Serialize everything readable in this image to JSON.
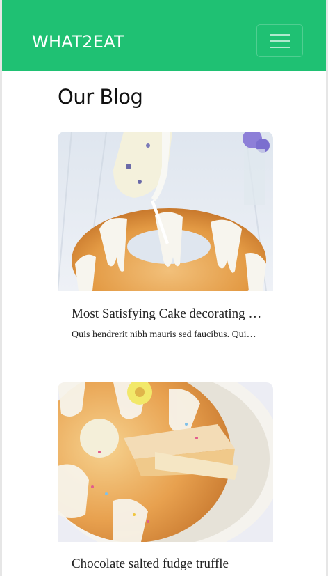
{
  "navbar": {
    "brand": "WHAT2EAT",
    "toggle_icon": "hamburger-menu-icon",
    "color": "#1fc173"
  },
  "blog": {
    "title": "Our Blog",
    "posts": [
      {
        "title": "Most Satisfying Cake decorating ideas",
        "excerpt": "Quis hendrerit nibh mauris sed faucibus. Quisque at diam et nisi",
        "image": "bundt-cake-with-icing-pour-photo"
      },
      {
        "title": "Chocolate salted fudge truffle",
        "excerpt": "",
        "image": "sliced-bundt-cake-with-sprinkles-photo"
      }
    ]
  }
}
